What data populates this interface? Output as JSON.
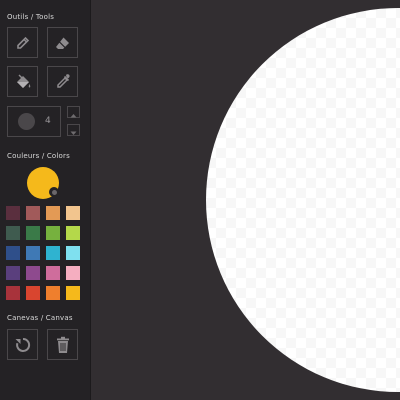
{
  "sidebar": {
    "tools_title": "Outils / Tools",
    "colors_title": "Couleurs / Colors",
    "canvas_title": "Canevas / Canvas",
    "brush_size": "4"
  },
  "colors": {
    "current": "#f5b91b",
    "palette": [
      "#5a2f3e",
      "#a15a5a",
      "#e39a55",
      "#f2c58e",
      "#3f5b4f",
      "#3a7a48",
      "#76b13e",
      "#b4d84a",
      "#2f4f8a",
      "#3f79b5",
      "#2fb3d0",
      "#7fe0ef",
      "#5a3f7d",
      "#8e4a8e",
      "#cf6d9c",
      "#f5aec0",
      "#a8333b",
      "#d9452f",
      "#ef7f2d",
      "#f5b91b"
    ]
  },
  "icons": {
    "pencil": "pencil-icon",
    "eraser": "eraser-icon",
    "fill": "paint-bucket-icon",
    "picker": "eyedropper-icon",
    "undo": "undo-icon",
    "trash": "trash-icon"
  }
}
